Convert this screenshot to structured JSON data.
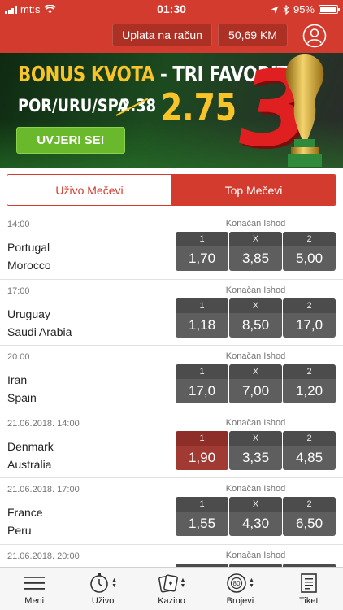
{
  "status_bar": {
    "carrier": "mt:s",
    "time": "01:30",
    "battery": "95%",
    "battery_level": 0.95
  },
  "account": {
    "deposit_label": "Uplata na račun",
    "balance": "50,69 KM"
  },
  "banner": {
    "title_part1": "BONUS KVOTA",
    "title_dash": " - ",
    "title_part2": "TRI FAVORITA",
    "teams": "POR/URU/SPA",
    "old_odd": "2.38",
    "new_odd": "2.75",
    "big_number": "3",
    "cta_label": "UVJERI SE!"
  },
  "tabs": [
    {
      "label": "Uživo Mečevi",
      "active": false
    },
    {
      "label": "Top Mečevi",
      "active": true
    }
  ],
  "odds_headers": {
    "home": "1",
    "draw": "X",
    "away": "2"
  },
  "matches": [
    {
      "time": "14:00",
      "market": "Konačan Ishod",
      "home": "Portugal",
      "away": "Morocco",
      "odd_1": "1,70",
      "odd_x": "3,85",
      "odd_2": "5,00"
    },
    {
      "time": "17:00",
      "market": "Konačan Ishod",
      "home": "Uruguay",
      "away": "Saudi Arabia",
      "odd_1": "1,18",
      "odd_x": "8,50",
      "odd_2": "17,0"
    },
    {
      "time": "20:00",
      "market": "Konačan Ishod",
      "home": "Iran",
      "away": "Spain",
      "odd_1": "17,0",
      "odd_x": "7,00",
      "odd_2": "1,20"
    },
    {
      "time": "21.06.2018. 14:00",
      "market": "Konačan Ishod",
      "home": "Denmark",
      "away": "Australia",
      "odd_1": "1,90",
      "odd_x": "3,35",
      "odd_2": "4,85",
      "selected": "1"
    },
    {
      "time": "21.06.2018. 17:00",
      "market": "Konačan Ishod",
      "home": "France",
      "away": "Peru",
      "odd_1": "1,55",
      "odd_x": "4,30",
      "odd_2": "6,50"
    },
    {
      "time": "21.06.2018. 20:00",
      "market": "Konačan Ishod",
      "home": "",
      "away": "",
      "odd_1": "",
      "odd_x": "",
      "odd_2": ""
    }
  ],
  "bottom_nav": [
    {
      "label": "Meni",
      "icon": "menu-icon"
    },
    {
      "label": "Uživo",
      "icon": "stopwatch-icon"
    },
    {
      "label": "Kazino",
      "icon": "cards-icon"
    },
    {
      "label": "Brojevi",
      "icon": "lottery-ball-icon"
    },
    {
      "label": "Tiket",
      "icon": "ticket-icon"
    }
  ],
  "colors": {
    "brand_red": "#d33b2e",
    "odd_bg": "#5e5e5e",
    "odd_selected": "#a03a33",
    "cta_green": "#6ab82b",
    "banner_gold": "#f7c42a"
  }
}
